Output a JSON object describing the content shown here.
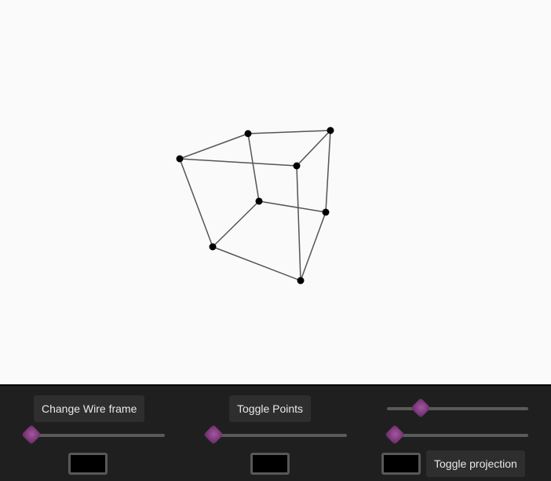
{
  "buttons": {
    "wireframe_label": "Change Wire frame",
    "points_label": "Toggle Points",
    "projection_label": "Toggle projection"
  },
  "sliders": {
    "top_right": 0.24,
    "left": 0.0,
    "middle": 0.0,
    "right": 0.05
  },
  "swatches": {
    "left": "#000000",
    "middle": "#000000",
    "right": "#000000"
  },
  "colors": {
    "viewport_bg": "#fafafa",
    "panel_bg": "#1f1f1f",
    "edge_color": "#555555",
    "vertex_color": "#000000",
    "slider_thumb": "#8e4a8b"
  }
}
